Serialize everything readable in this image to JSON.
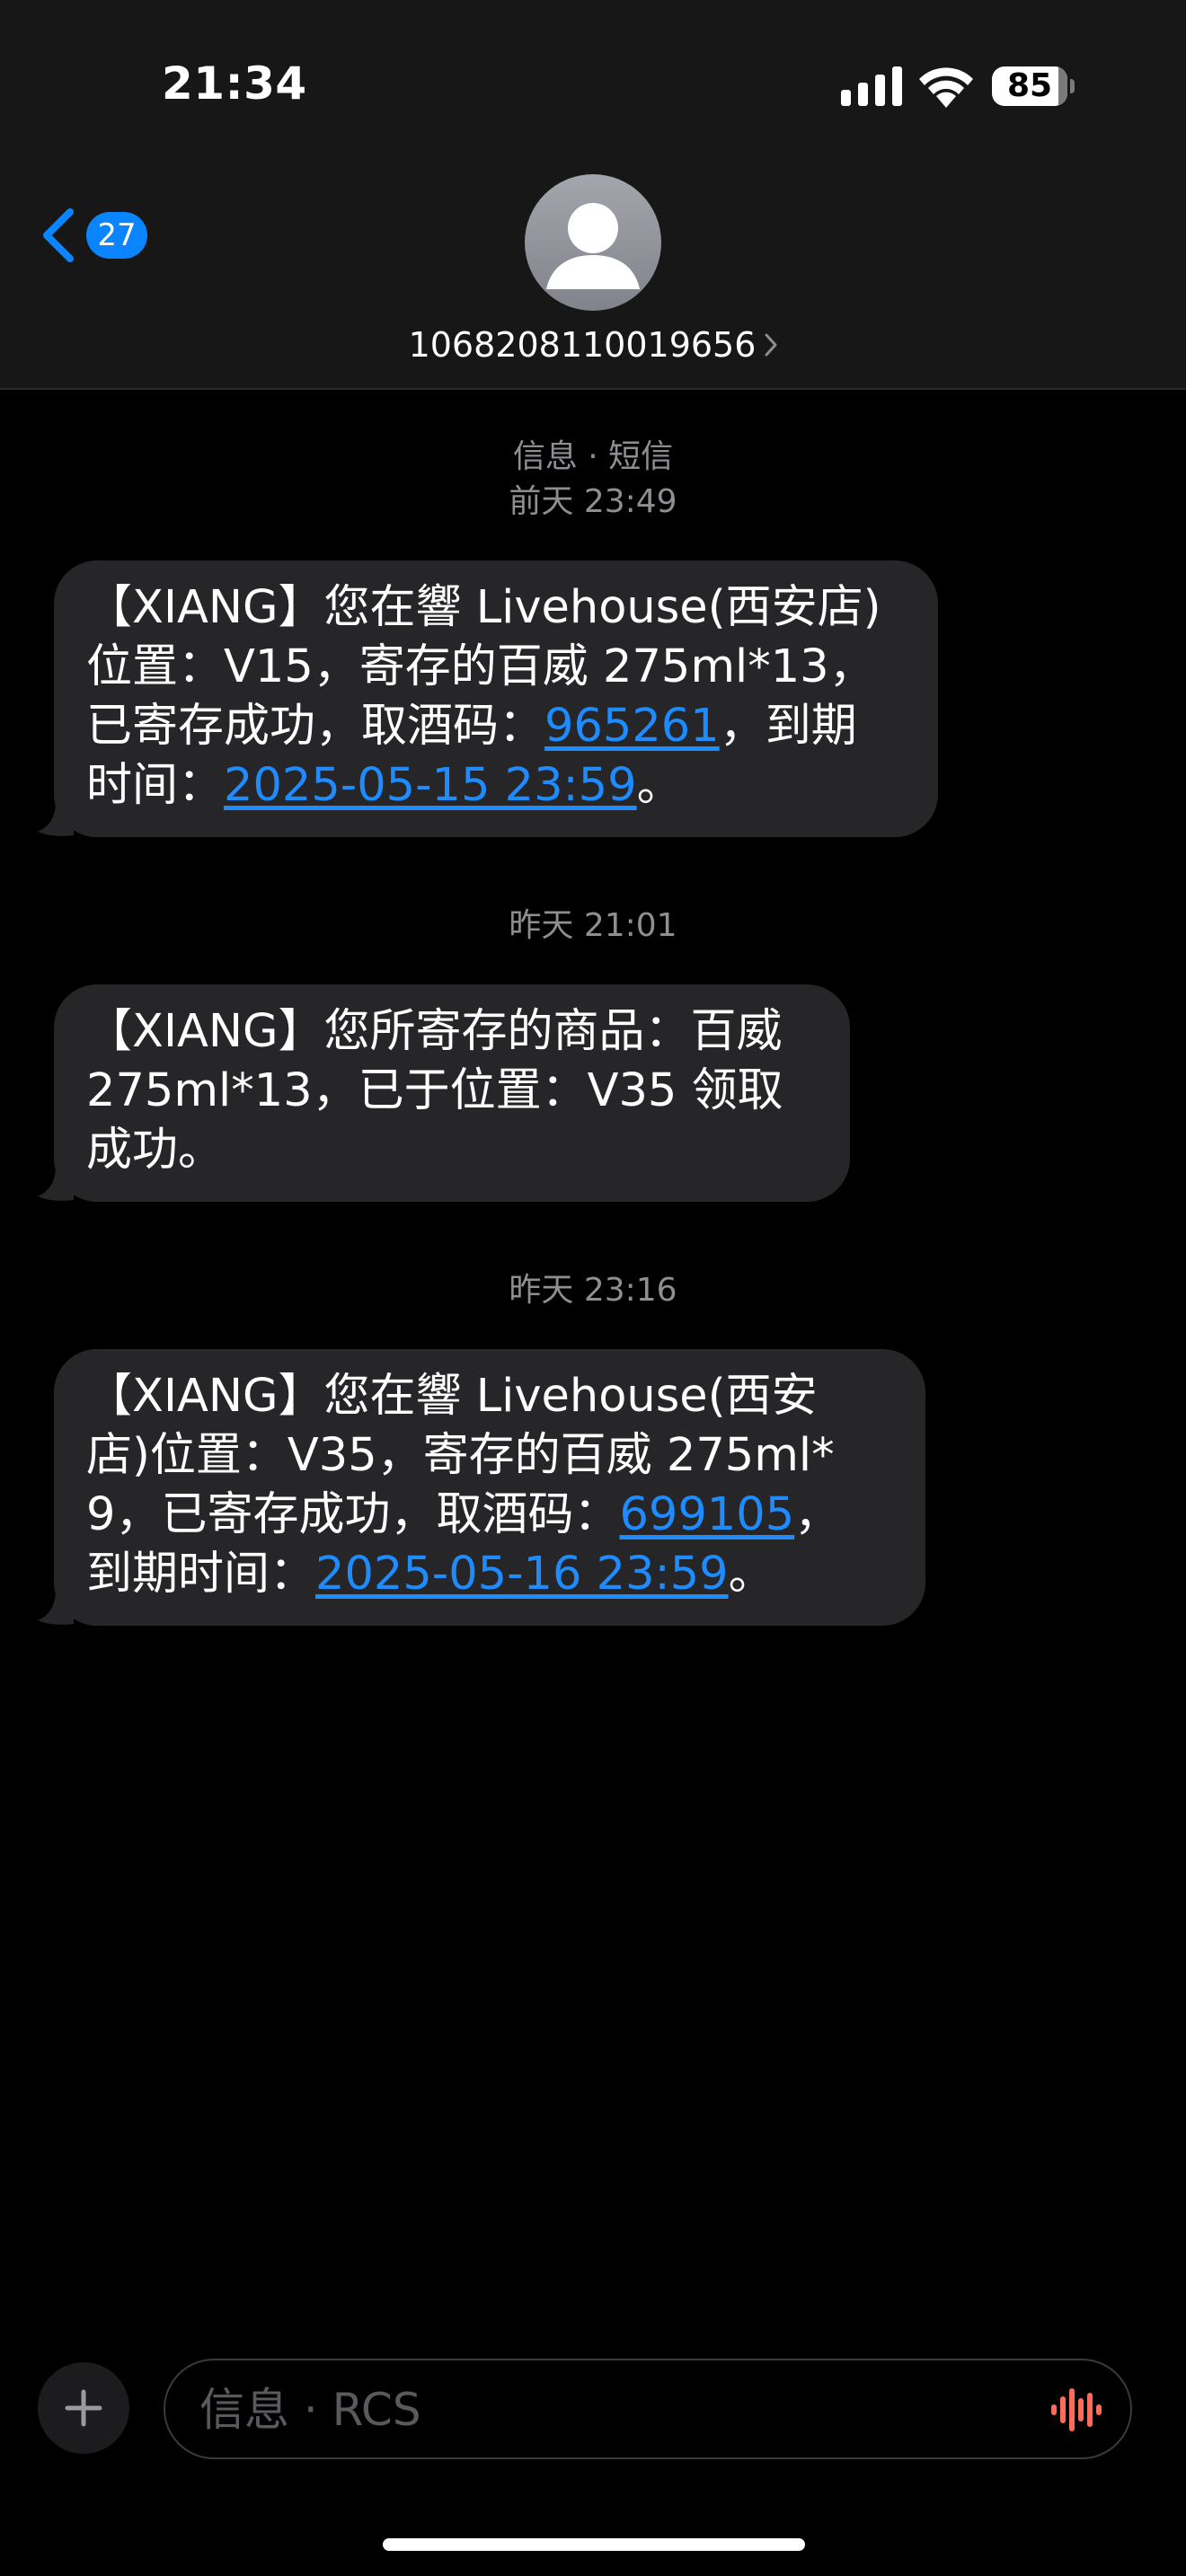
{
  "status_bar": {
    "time": "21:34",
    "battery_level": "85"
  },
  "header": {
    "back_count": "27",
    "contact_name": "1068208110019656"
  },
  "thread": {
    "service_label": "信息 · 短信",
    "messages": [
      {
        "timestamp": "前天 23:49",
        "text_before": "【XIANG】您在響 Livehouse(西安店)位置：V15，寄存的百威 275ml*13，已寄存成功，取酒码：",
        "code": "965261",
        "text_middle": "，到期时间：",
        "expiry": "2025-05-15 23:59",
        "text_after": "。"
      },
      {
        "timestamp": "昨天 21:01",
        "text": "【XIANG】您所寄存的商品：百威 275ml*13，已于位置：V35 领取成功。"
      },
      {
        "timestamp": "昨天 23:16",
        "text_before": "【XIANG】您在響 Livehouse(西安店)位置：V35，寄存的百威 275ml*9，已寄存成功，取酒码：",
        "code": "699105",
        "text_middle": "，到期时间：",
        "expiry": "2025-05-16 23:59",
        "text_after": "。"
      }
    ]
  },
  "composer": {
    "placeholder": "信息 · RCS"
  },
  "colors": {
    "link": "#1e8bff",
    "bubble": "#262628",
    "badge": "#0a84ff",
    "voice": "#ff6b5b"
  }
}
